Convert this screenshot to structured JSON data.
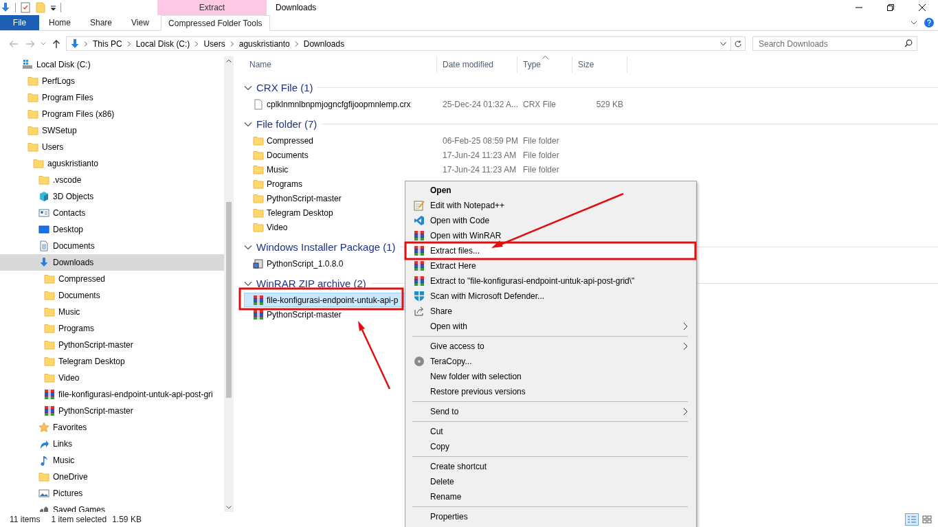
{
  "window": {
    "title": "Downloads"
  },
  "ribbon": {
    "contextual_label": "Extract",
    "tabs": [
      {
        "label": "File",
        "kind": "backstage",
        "selected": false
      },
      {
        "label": "Home",
        "kind": "tab",
        "selected": false
      },
      {
        "label": "Share",
        "kind": "tab",
        "selected": false
      },
      {
        "label": "View",
        "kind": "tab",
        "selected": false
      },
      {
        "label": "Compressed Folder Tools",
        "kind": "contextual",
        "selected": true
      }
    ]
  },
  "address": {
    "crumbs": [
      "This PC",
      "Local Disk (C:)",
      "Users",
      "aguskristianto",
      "Downloads"
    ]
  },
  "search": {
    "placeholder": "Search Downloads"
  },
  "nav_tree": [
    {
      "label": "Local Disk (C:)",
      "kind": "drive",
      "selected": false,
      "children": [
        {
          "label": "PerfLogs",
          "kind": "folder",
          "selected": false
        },
        {
          "label": "Program Files",
          "kind": "folder",
          "selected": false
        },
        {
          "label": "Program Files (x86)",
          "kind": "folder",
          "selected": false
        },
        {
          "label": "SWSetup",
          "kind": "folder",
          "selected": false
        },
        {
          "label": "Users",
          "kind": "folder",
          "selected": false,
          "children": [
            {
              "label": "aguskristianto",
              "kind": "folder",
              "selected": false,
              "children": [
                {
                  "label": ".vscode",
                  "kind": "folder",
                  "selected": false
                },
                {
                  "label": "3D Objects",
                  "kind": "objects3d",
                  "selected": false
                },
                {
                  "label": "Contacts",
                  "kind": "contacts",
                  "selected": false
                },
                {
                  "label": "Desktop",
                  "kind": "desktop",
                  "selected": false
                },
                {
                  "label": "Documents",
                  "kind": "documents",
                  "selected": false
                },
                {
                  "label": "Downloads",
                  "kind": "downloads",
                  "selected": true,
                  "children": [
                    {
                      "label": "Compressed",
                      "kind": "folder",
                      "selected": false
                    },
                    {
                      "label": "Documents",
                      "kind": "folder",
                      "selected": false
                    },
                    {
                      "label": "Music",
                      "kind": "folder",
                      "selected": false
                    },
                    {
                      "label": "Programs",
                      "kind": "folder",
                      "selected": false
                    },
                    {
                      "label": "PythonScript-master",
                      "kind": "folder",
                      "selected": false
                    },
                    {
                      "label": "Telegram Desktop",
                      "kind": "folder",
                      "selected": false
                    },
                    {
                      "label": "Video",
                      "kind": "folder",
                      "selected": false
                    },
                    {
                      "label": "file-konfigurasi-endpoint-untuk-api-post-gri",
                      "kind": "archive",
                      "selected": false
                    },
                    {
                      "label": "PythonScript-master",
                      "kind": "archive",
                      "selected": false
                    }
                  ]
                },
                {
                  "label": "Favorites",
                  "kind": "favorites",
                  "selected": false
                },
                {
                  "label": "Links",
                  "kind": "links",
                  "selected": false
                },
                {
                  "label": "Music",
                  "kind": "music",
                  "selected": false
                },
                {
                  "label": "OneDrive",
                  "kind": "folder",
                  "selected": false
                },
                {
                  "label": "Pictures",
                  "kind": "pictures",
                  "selected": false
                },
                {
                  "label": "Saved Games",
                  "kind": "games",
                  "selected": false
                }
              ]
            }
          ]
        }
      ]
    }
  ],
  "columns": [
    {
      "label": "Name",
      "sorted": false
    },
    {
      "label": "Date modified",
      "sorted": false
    },
    {
      "label": "Type",
      "sorted": true
    },
    {
      "label": "Size",
      "sorted": false
    }
  ],
  "groups": [
    {
      "title": "CRX File (1)",
      "expanded": true,
      "rows": [
        {
          "name": "cplklnmnlbnpmjogncfgfijoopmnlemp.crx",
          "date": "25-Dec-24 01:32 A...",
          "type": "CRX File",
          "size": "529 KB",
          "kind": "file",
          "selected": false
        }
      ]
    },
    {
      "title": "File folder (7)",
      "expanded": true,
      "rows": [
        {
          "name": "Compressed",
          "date": "06-Feb-25 08:59 PM",
          "type": "File folder",
          "kind": "folder",
          "selected": false
        },
        {
          "name": "Documents",
          "date": "17-Jun-24 11:23 AM",
          "type": "File folder",
          "kind": "folder",
          "selected": false
        },
        {
          "name": "Music",
          "date": "17-Jun-24 11:23 AM",
          "type": "File folder",
          "kind": "folder",
          "selected": false
        },
        {
          "name": "Programs",
          "kind": "folder",
          "selected": false
        },
        {
          "name": "PythonScript-master",
          "kind": "folder",
          "selected": false
        },
        {
          "name": "Telegram Desktop",
          "kind": "folder",
          "selected": false
        },
        {
          "name": "Video",
          "kind": "folder",
          "selected": false
        }
      ]
    },
    {
      "title": "Windows Installer Package (1)",
      "expanded": true,
      "rows": [
        {
          "name": "PythonScript_1.0.8.0",
          "kind": "installer",
          "selected": false
        }
      ]
    },
    {
      "title": "WinRAR ZIP archive (2)",
      "expanded": true,
      "rows": [
        {
          "name": "file-konfigurasi-endpoint-untuk-api-p",
          "kind": "archive",
          "selected": true
        },
        {
          "name": "PythonScript-master",
          "kind": "archive",
          "selected": false
        }
      ]
    }
  ],
  "context_menu": {
    "sections": [
      [
        {
          "label": "Open",
          "kind": "none",
          "default": true,
          "highlighted": false,
          "submenu": false
        },
        {
          "label": "Edit with Notepad++",
          "kind": "notepad",
          "default": false,
          "highlighted": false,
          "submenu": false
        },
        {
          "label": "Open with Code",
          "kind": "vscode",
          "default": false,
          "highlighted": false,
          "submenu": false
        },
        {
          "label": "Open with WinRAR",
          "kind": "winrar",
          "default": false,
          "highlighted": false,
          "submenu": false
        },
        {
          "label": "Extract files...",
          "kind": "winrar",
          "default": false,
          "highlighted": true,
          "submenu": false
        },
        {
          "label": "Extract Here",
          "kind": "winrar",
          "default": false,
          "highlighted": false,
          "submenu": false
        },
        {
          "label": "Extract to \"file-konfigurasi-endpoint-untuk-api-post-grid\\\"",
          "kind": "winrar",
          "default": false,
          "highlighted": false,
          "submenu": false
        },
        {
          "label": "Scan with Microsoft Defender...",
          "kind": "defender",
          "default": false,
          "highlighted": false,
          "submenu": false
        },
        {
          "label": "Share",
          "kind": "share",
          "default": false,
          "highlighted": false,
          "submenu": false
        },
        {
          "label": "Open with",
          "kind": "none",
          "default": false,
          "highlighted": false,
          "submenu": true
        }
      ],
      [
        {
          "label": "Give access to",
          "kind": "none",
          "default": false,
          "highlighted": false,
          "submenu": true
        },
        {
          "label": "TeraCopy...",
          "kind": "teracopy",
          "default": false,
          "highlighted": false,
          "submenu": false
        },
        {
          "label": "New folder with selection",
          "kind": "none",
          "default": false,
          "highlighted": false,
          "submenu": false
        },
        {
          "label": "Restore previous versions",
          "kind": "none",
          "default": false,
          "highlighted": false,
          "submenu": false
        }
      ],
      [
        {
          "label": "Send to",
          "kind": "none",
          "default": false,
          "highlighted": false,
          "submenu": true
        }
      ],
      [
        {
          "label": "Cut",
          "kind": "none",
          "default": false,
          "highlighted": false,
          "submenu": false
        },
        {
          "label": "Copy",
          "kind": "none",
          "default": false,
          "highlighted": false,
          "submenu": false
        }
      ],
      [
        {
          "label": "Create shortcut",
          "kind": "none",
          "default": false,
          "highlighted": false,
          "submenu": false
        },
        {
          "label": "Delete",
          "kind": "none",
          "default": false,
          "highlighted": false,
          "submenu": false
        },
        {
          "label": "Rename",
          "kind": "none",
          "default": false,
          "highlighted": false,
          "submenu": false
        }
      ],
      [
        {
          "label": "Properties",
          "kind": "none",
          "default": false,
          "highlighted": false,
          "submenu": false
        }
      ]
    ]
  },
  "status_bar": {
    "item_count": "11 items",
    "selection": "1 item selected",
    "selection_size": "1.59 KB"
  }
}
